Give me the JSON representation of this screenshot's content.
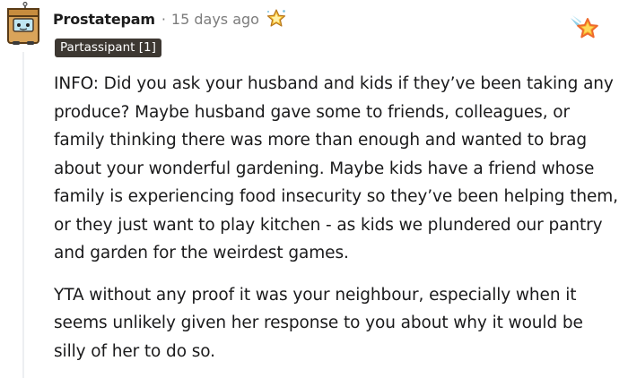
{
  "comment": {
    "username": "Prostatepam",
    "separator": "·",
    "timestamp": "15 days ago",
    "flair": "Partassipant [1]",
    "avatar_icon": "snoo-box-avatar-icon",
    "inline_award_icon": "star-award-icon",
    "award_button_icon": "give-award-star-icon",
    "paragraphs": [
      "INFO: Did you ask your husband and kids if they’ve been taking any produce? Maybe husband gave some to friends, colleagues, or family thinking there was more than enough and wanted to brag about your wonderful gardening. Maybe kids have a friend whose family is experiencing food insecurity so they’ve been helping them, or they just want to play kitchen - as kids we plundered our pantry and garden for the weirdest games.",
      "YTA without any proof it was your neighbour, especially when it seems unlikely given her response to you about why it would be silly of her to do so."
    ]
  },
  "colors": {
    "flair_bg": "#3d3832",
    "flair_text": "#ffffff",
    "meta_text": "#7c7c7c",
    "body_text": "#1a1a1b",
    "star_gold": "#f7b52b",
    "star_orange": "#ee6a2c"
  }
}
